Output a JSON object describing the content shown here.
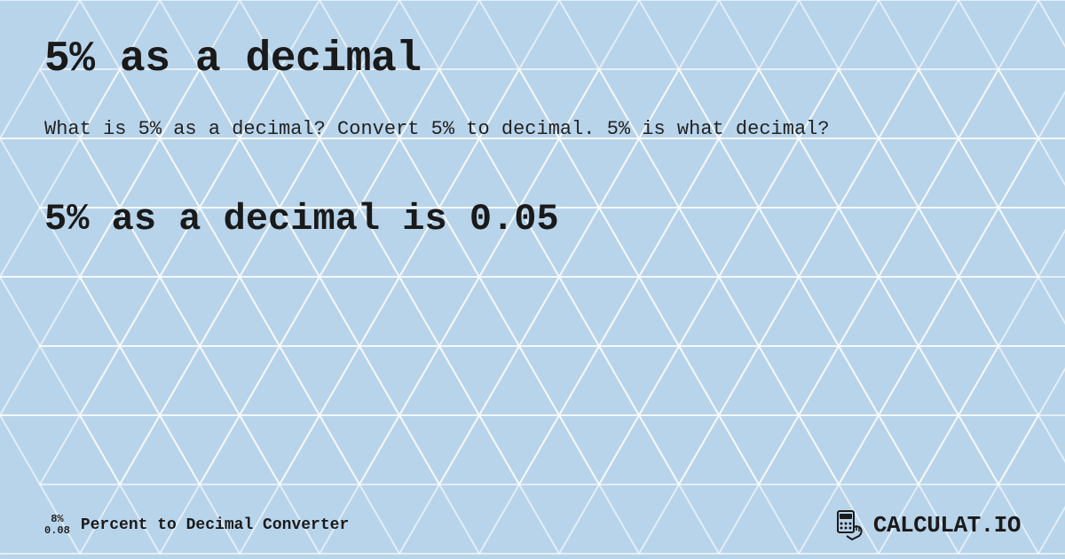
{
  "page": {
    "title": "5% as a decimal",
    "description": "What is 5% as a decimal? Convert 5% to decimal. 5% is what decimal?",
    "result": "5% as a decimal is 0.05",
    "background_color": "#c8dff0"
  },
  "footer": {
    "fraction_top": "8%",
    "fraction_bottom": "0.08",
    "label": "Percent to Decimal Converter",
    "logo_text": "CALCULAT.IO"
  }
}
